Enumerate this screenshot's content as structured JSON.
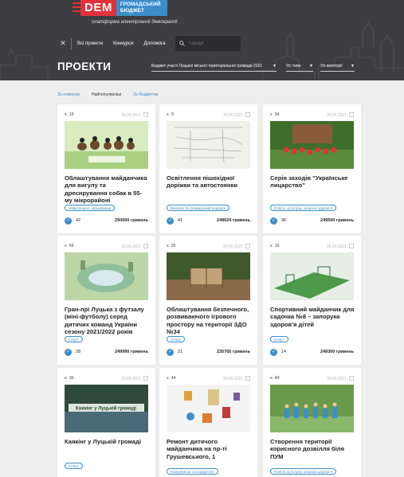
{
  "header": {
    "logo_dem": "DEM",
    "logo_budget_line1": "ГРОМАДСЬКИЙ",
    "logo_budget_line2": "БЮДЖЕТ",
    "tagline": "платформа електронної демократії",
    "nav": [
      "Всі проекти",
      "Конкурси",
      "Допомога"
    ],
    "search_placeholder": "Пошук"
  },
  "page_title": "ПРОЕКТИ",
  "filters": {
    "contest": "Бюджет участі Луцької міської територіальної громади 2021",
    "type": "Усі типи",
    "category": "Усі категорії"
  },
  "sort": [
    "За номером",
    "Найпопулярніші",
    "За бюджетом"
  ],
  "projects": [
    {
      "id": "19",
      "date": "28.09.2021",
      "title": "Облаштування майданчика для вигулу та дресирування собак в 55-му мікрорайоні",
      "tag": "Навколишнє середовище",
      "votes": "42",
      "amount": "250000 гривень"
    },
    {
      "id": "3",
      "date": "15.09.2021",
      "title": "Освітлення пішохідної доріжки та автостоянки",
      "tag": "Безпека та громадський порядок",
      "votes": "41",
      "amount": "249624 гривень"
    },
    {
      "id": "54",
      "date": "30.09.2021",
      "title": "Серія заходів \"Українське лицарство\"",
      "tag": "Освіта, культура, охорона здоров'я",
      "votes": "36",
      "amount": "249500 гривень"
    },
    {
      "id": "56",
      "date": "30.09.2021",
      "title": "Гран-прі Луцька з футзалу (міні-футболу) серед дитячих команд України сезону 2021/2022 років",
      "tag": "Спорт",
      "votes": "28",
      "amount": "249990 гривень"
    },
    {
      "id": "32",
      "date": "29.09.2021",
      "title": "Облаштування безпечного, розвиваючого ігрового простору на території ЗДО №34",
      "tag": "Спорт",
      "votes": "21",
      "amount": "235765 гривень"
    },
    {
      "id": "16",
      "date": "28.09.2021",
      "title": "Спортивний майданчик для садочка №8 – запорука здоров'я дітей",
      "tag": "Спорт",
      "votes": "14",
      "amount": "249300 гривень"
    },
    {
      "id": "30",
      "date": "29.09.2021",
      "title": "Каякінг у Луцькій громаді",
      "tag": "Спорт",
      "votes": "",
      "amount": "",
      "image_text": "Каякінг у Луцькій громаді"
    },
    {
      "id": "44",
      "date": "29.09.2021",
      "title": "Ремонт дитячого майданчика на пр-ті Грушевського, 1",
      "tag": "Комунальне господарство",
      "votes": "",
      "amount": ""
    },
    {
      "id": "49",
      "date": "30.09.2021",
      "title": "Створення території корисного дозвілля біля ПУМ",
      "tag": "Освіта, культура, охорона здоров'я",
      "votes": "",
      "amount": ""
    }
  ],
  "colors": {
    "header_bg": "#3e3e42",
    "accent_red": "#e3313a",
    "accent_blue": "#3b8ec9",
    "page_bg": "#eeeeee"
  }
}
